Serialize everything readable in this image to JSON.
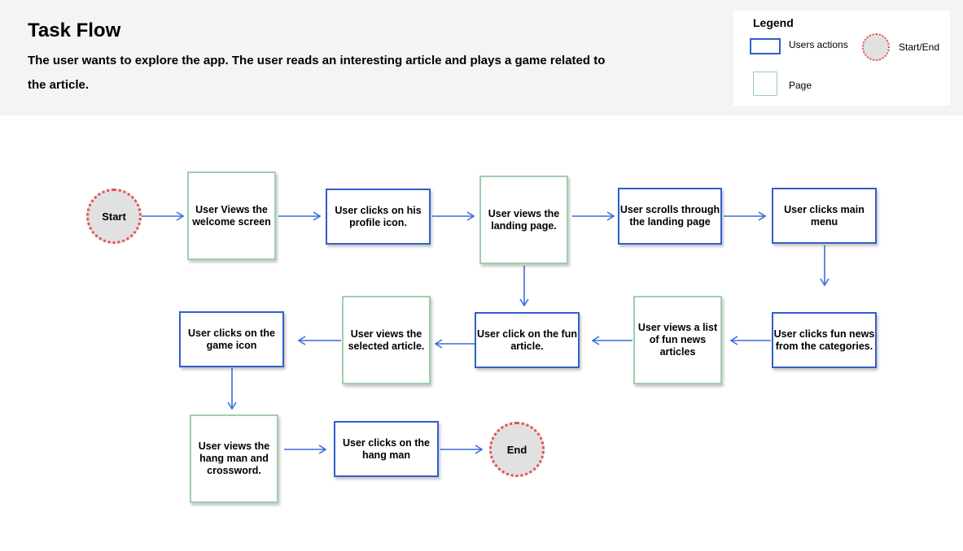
{
  "header": {
    "title": "Task Flow",
    "description": "The user wants to explore the app. The user reads an interesting article and plays a game related to the article."
  },
  "legend": {
    "title": "Legend",
    "users_actions": "Users actions",
    "start_end": "Start/End",
    "page": "Page"
  },
  "colors": {
    "action_border": "#2f5fcc",
    "page_border": "#9dcfaa",
    "terminal_border": "#e65050",
    "terminal_fill": "#e1e1e1",
    "arrow": "#3a6fd6",
    "header_bg": "#f4f4f4"
  },
  "nodes": {
    "start": "Start",
    "welcome": "User Views the welcome screen",
    "profile": "User clicks on his profile icon.",
    "landing": "User views the landing page.",
    "scroll": "User scrolls through the landing page",
    "menu": "User clicks main menu",
    "categories": "User clicks fun news from the categories.",
    "list": "User views a list of fun news articles",
    "fun_article": "User click on the fun article.",
    "selected": "User views the selected article.",
    "game_icon": "User clicks on the game icon",
    "hangman_view": "User views the hang man and crossword.",
    "hangman_click": "User clicks on the hang man",
    "end": "End"
  }
}
